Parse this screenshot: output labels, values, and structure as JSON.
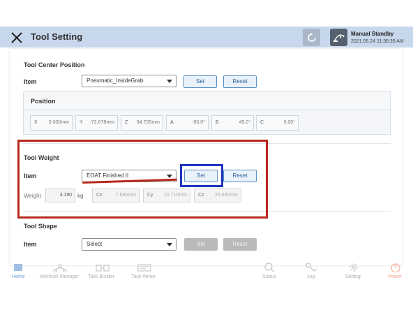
{
  "header": {
    "title": "Tool Setting",
    "status": "Manual Standby",
    "timestamp": "2021.05.24 11:36:39 AM",
    "icons": [
      "close-icon",
      "refresh-icon",
      "robot-arm-icon"
    ]
  },
  "tcp": {
    "section_title": "Tool Center Position",
    "item_label": "Item",
    "selected": "Pneumatic_InsideGrab",
    "set_label": "Set",
    "reset_label": "Reset",
    "position_title": "Position",
    "fields": [
      {
        "label": "X",
        "value": "0.000",
        "unit": "mm"
      },
      {
        "label": "Y",
        "value": "-72.678",
        "unit": "mm"
      },
      {
        "label": "Z",
        "value": "94.725",
        "unit": "mm"
      },
      {
        "label": "A",
        "value": "-90.0",
        "unit": "°"
      },
      {
        "label": "B",
        "value": "45.0",
        "unit": "°"
      },
      {
        "label": "C",
        "value": "0.00",
        "unit": "°"
      }
    ]
  },
  "weight": {
    "section_title": "Tool Weight",
    "item_label": "Item",
    "selected": "EOAT Finished II",
    "set_label": "Set",
    "reset_label": "Reset",
    "weight_label": "Weight",
    "weight_value": "3.190",
    "weight_unit": "kg",
    "cog": [
      {
        "label": "Cx",
        "value": "7.690",
        "unit": "mm"
      },
      {
        "label": "Cy",
        "value": "15.710",
        "unit": "mm"
      },
      {
        "label": "Cz",
        "value": "25.690",
        "unit": "mm"
      }
    ]
  },
  "shape": {
    "section_title": "Tool Shape",
    "item_label": "Item",
    "selected": "Select",
    "set_label": "Set",
    "reset_label": "Reset"
  },
  "nav": {
    "items": [
      {
        "label": "Home",
        "icon": "home-icon",
        "active": true
      },
      {
        "label": "Workcell Manager",
        "icon": "workcell-icon"
      },
      {
        "label": "Task Builder",
        "icon": "task-builder-icon"
      },
      {
        "label": "Task Writer",
        "icon": "task-writer-icon"
      },
      {
        "label": "Status",
        "icon": "status-icon"
      },
      {
        "label": "Jog",
        "icon": "jog-icon"
      },
      {
        "label": "Setting",
        "icon": "gear-icon"
      },
      {
        "label": "Power",
        "icon": "power-icon"
      }
    ]
  },
  "colors": {
    "header_bg": "#c7d7ec",
    "accent": "#5b8fc2",
    "highlight_red": "#b8281e",
    "highlight_blue": "#1f36c0"
  }
}
